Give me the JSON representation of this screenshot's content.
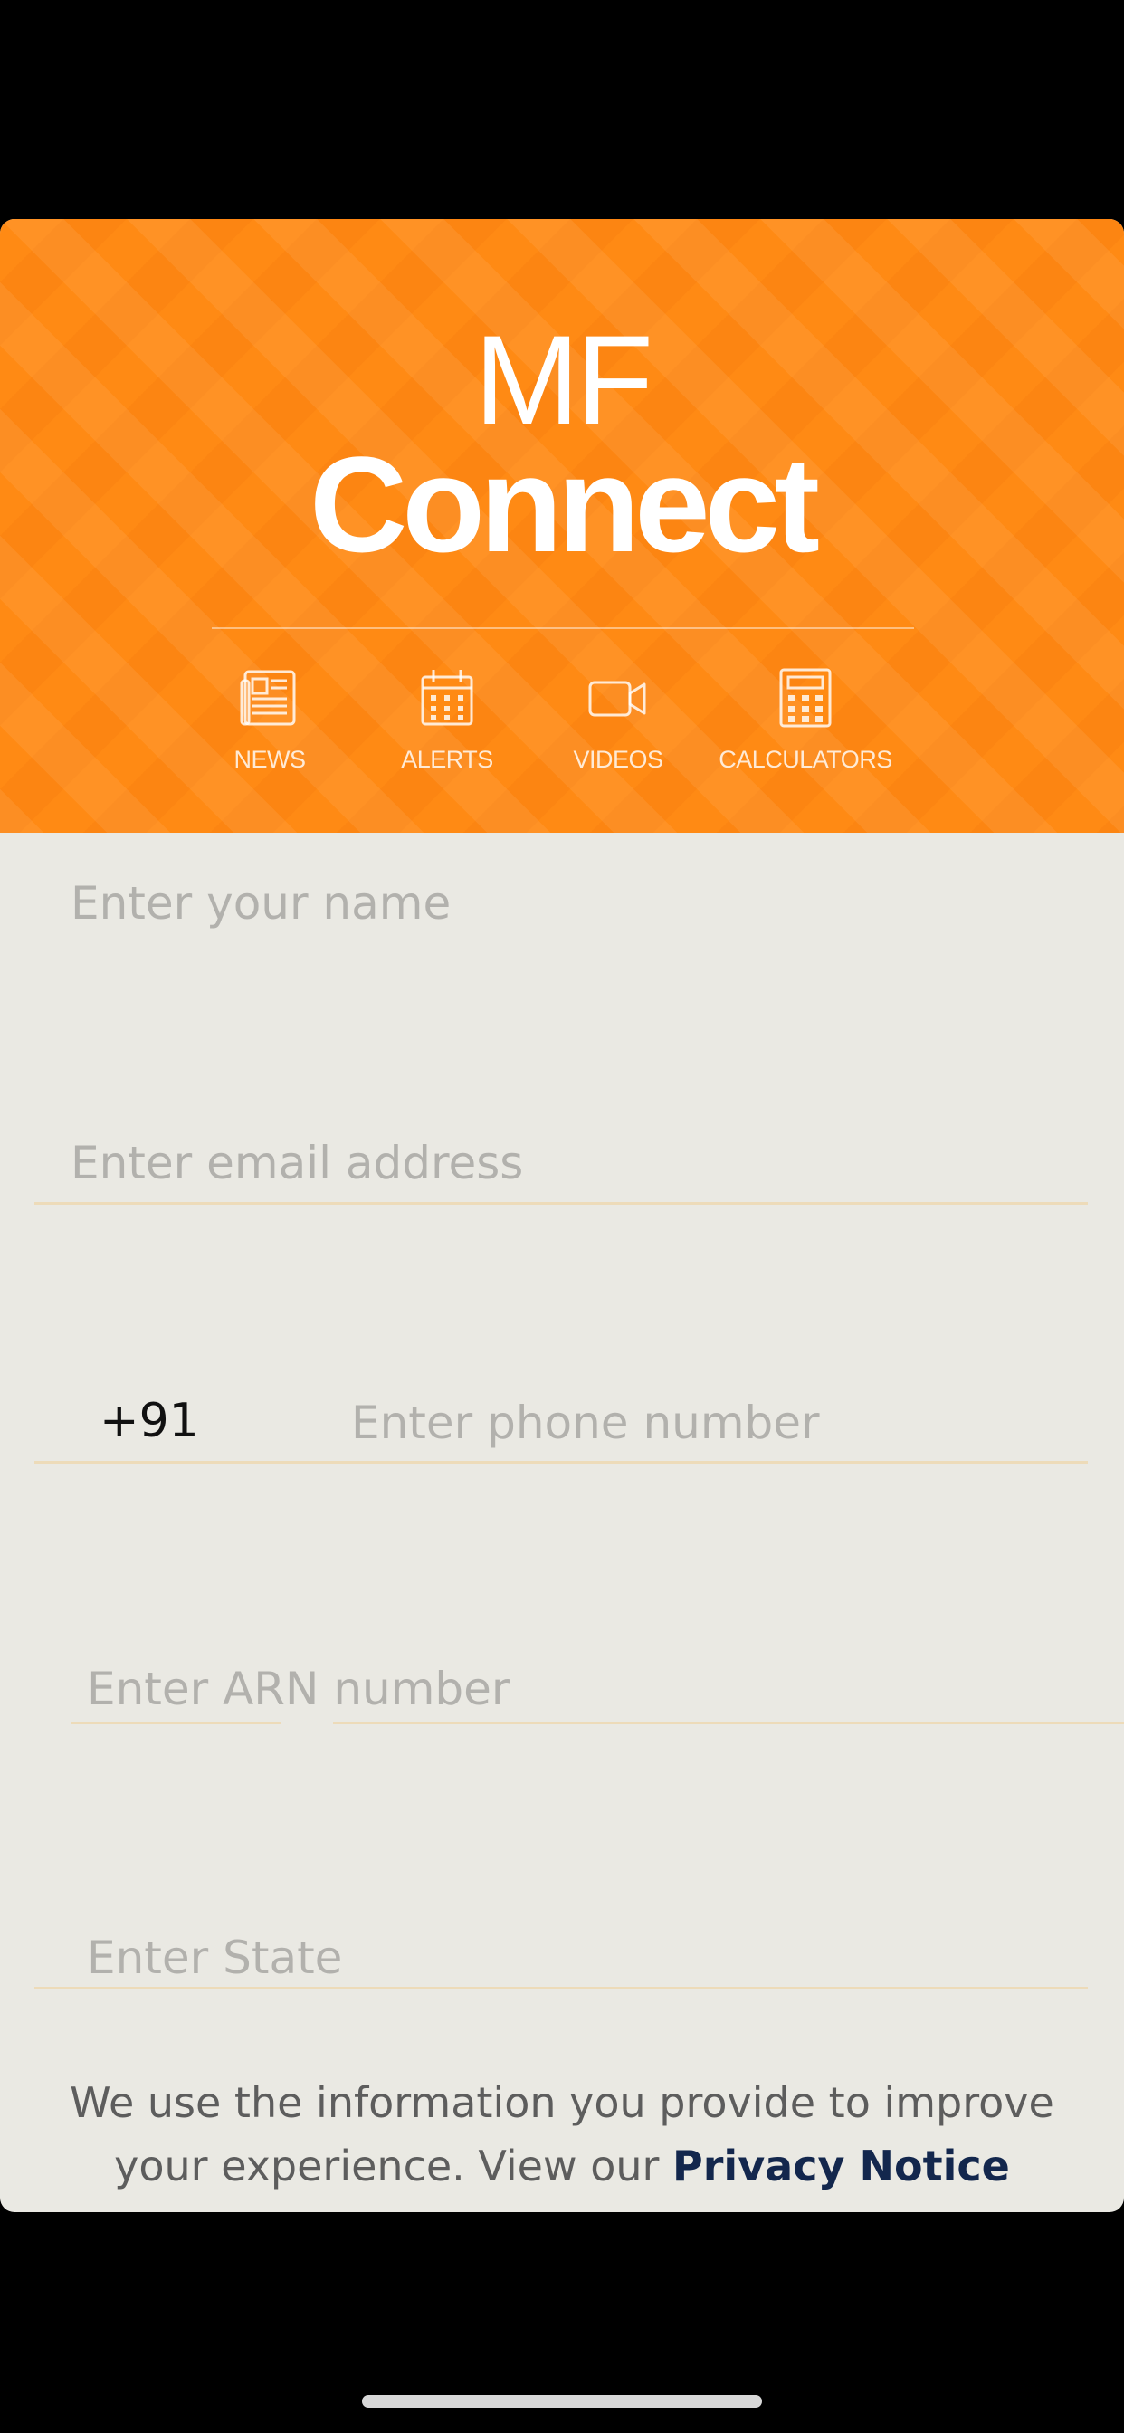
{
  "app": {
    "logo_line1": "MF",
    "logo_line2": "Connect"
  },
  "nav": {
    "items": [
      {
        "label": "NEWS",
        "icon": "newspaper-icon"
      },
      {
        "label": "ALERTS",
        "icon": "calendar-icon"
      },
      {
        "label": "VIDEOS",
        "icon": "video-camera-icon"
      },
      {
        "label": "CALCULATORS",
        "icon": "calculator-icon"
      }
    ]
  },
  "form": {
    "name_placeholder": "Enter your name",
    "email_placeholder": "Enter email address",
    "country_code": "+91",
    "phone_placeholder": "Enter phone number",
    "arn_placeholder": "Enter ARN number",
    "state_placeholder": "Enter State"
  },
  "privacy": {
    "text": "We use the information you provide to improve your experience. View our ",
    "link_label": "Privacy Notice"
  },
  "colors": {
    "header_orange": "#ff8a14",
    "form_background": "#eae9e3",
    "underline": "#eddbb9",
    "link": "#13274d"
  }
}
